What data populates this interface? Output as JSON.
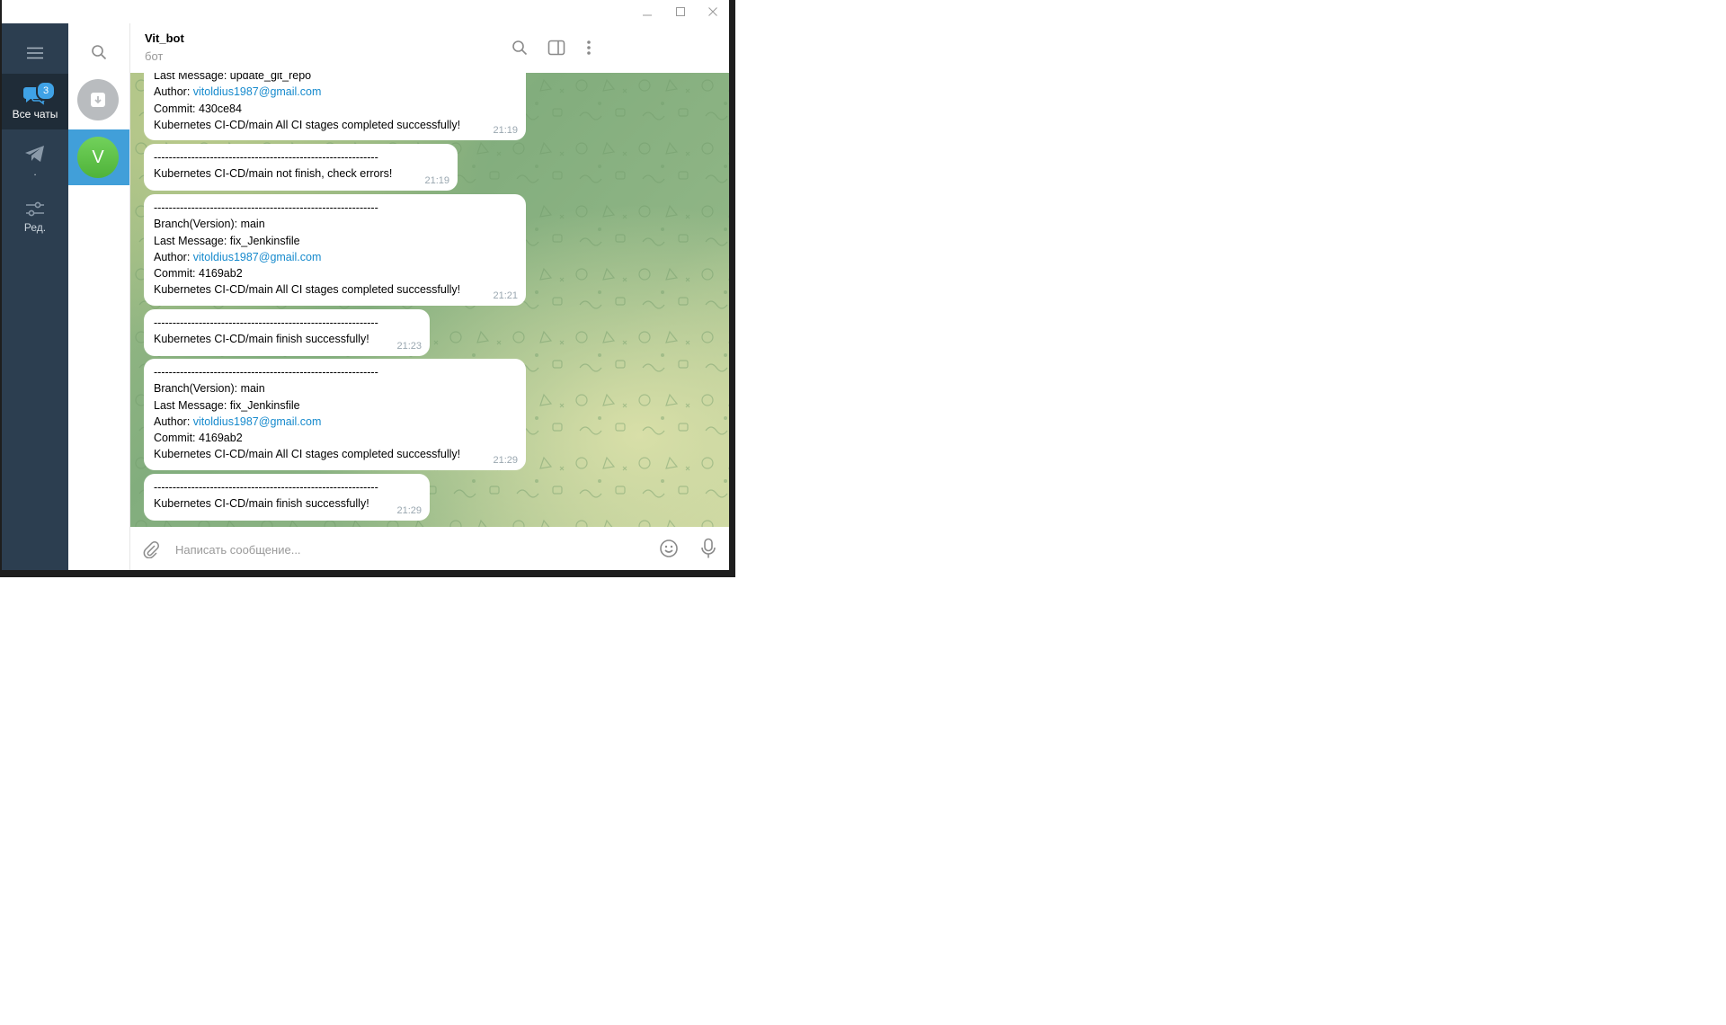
{
  "window": {
    "minimize_icon": "minimize-icon",
    "maximize_icon": "maximize-icon",
    "close_icon": "close-icon"
  },
  "folders": {
    "menu_icon": "hamburger-menu-icon",
    "items": [
      {
        "label": "Все чаты",
        "badge": "3",
        "icon": "chats-icon"
      },
      {
        "label": ".",
        "icon": "telegram-plane-icon"
      },
      {
        "label": "Ред.",
        "icon": "sliders-icon"
      }
    ]
  },
  "chat_list": {
    "search_icon": "search-icon",
    "archive_icon": "archive-icon",
    "active_chat_initial": "V"
  },
  "header": {
    "title": "Vit_bot",
    "status": "бот",
    "icons": [
      "search-icon",
      "sidebar-toggle-icon",
      "more-vertical-icon"
    ]
  },
  "messages": [
    {
      "lines": [
        {
          "text": "Last Message: update_git_repo"
        },
        {
          "label": "Author: ",
          "link": "vitoldius1987@gmail.com"
        },
        {
          "text": "Commit: 430ce84"
        },
        {
          "text": "Kubernetes CI-CD/main All CI stages completed successfully!"
        }
      ],
      "time": "21:19"
    },
    {
      "lines": [
        {
          "text": "------------------------------------------------------------"
        },
        {
          "text": "Kubernetes CI-CD/main not finish, check errors!"
        }
      ],
      "time": "21:19"
    },
    {
      "lines": [
        {
          "text": "------------------------------------------------------------"
        },
        {
          "text": "Branch(Version): main"
        },
        {
          "text": "Last Message: fix_Jenkinsfile"
        },
        {
          "label": "Author: ",
          "link": "vitoldius1987@gmail.com"
        },
        {
          "text": "Commit: 4169ab2"
        },
        {
          "text": "Kubernetes CI-CD/main All CI stages completed successfully!"
        }
      ],
      "time": "21:21"
    },
    {
      "lines": [
        {
          "text": "------------------------------------------------------------"
        },
        {
          "text": "Kubernetes CI-CD/main finish successfully!"
        }
      ],
      "time": "21:23"
    },
    {
      "lines": [
        {
          "text": "------------------------------------------------------------"
        },
        {
          "text": "Branch(Version): main"
        },
        {
          "text": "Last Message: fix_Jenkinsfile"
        },
        {
          "label": "Author: ",
          "link": "vitoldius1987@gmail.com"
        },
        {
          "text": "Commit: 4169ab2"
        },
        {
          "text": "Kubernetes CI-CD/main All CI stages completed successfully!"
        }
      ],
      "time": "21:29"
    },
    {
      "lines": [
        {
          "text": "------------------------------------------------------------"
        },
        {
          "text": "Kubernetes CI-CD/main finish successfully!"
        }
      ],
      "time": "21:29"
    }
  ],
  "composer": {
    "placeholder": "Написать сообщение...",
    "attach_icon": "paperclip-icon",
    "emoji_icon": "emoji-icon",
    "mic_icon": "microphone-icon"
  },
  "colors": {
    "sidebar_bg": "#2c3e50",
    "accent": "#419fd9",
    "link": "#168acd",
    "badge": "#3fa2e6"
  }
}
